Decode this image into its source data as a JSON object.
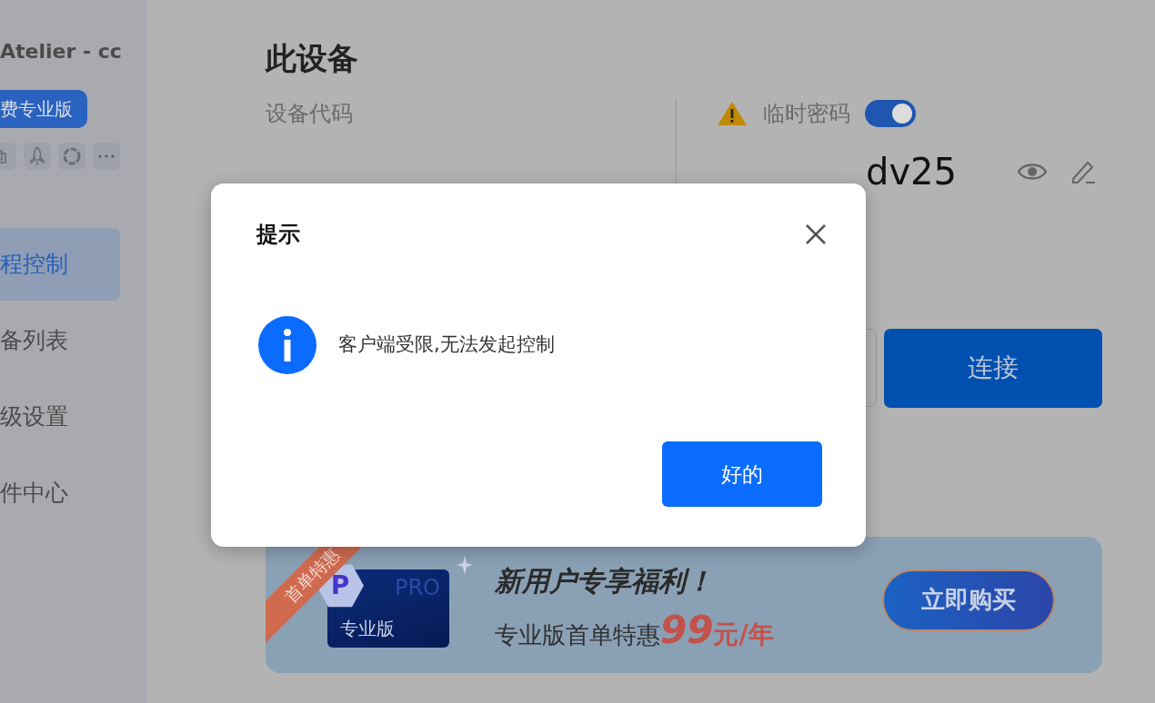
{
  "sidebar": {
    "title": "Atelier - cc",
    "upgrade_button": "费专业版",
    "nav_items": [
      {
        "label": "程控制",
        "selected": true
      },
      {
        "label": "备列表",
        "selected": false
      },
      {
        "label": "级设置",
        "selected": false
      },
      {
        "label": "件中心",
        "selected": false
      }
    ]
  },
  "main": {
    "heading": "此设备",
    "device_code": {
      "label": "设备代码"
    },
    "temp_password": {
      "label": "临时密码",
      "on": true,
      "value": "dv25"
    },
    "connect_button": "连接",
    "promo": {
      "ribbon": "首单特惠",
      "product_card": {
        "logo_letter": "P",
        "badge": "PRO",
        "label": "专业版"
      },
      "title": "新用户专享福利！",
      "subtitle": "专业版首单特惠",
      "price": "99",
      "unit": "元/年",
      "buy_button": "立即购买"
    }
  },
  "dialog": {
    "title": "提示",
    "message": "客户端受限,无法发起控制",
    "ok_button": "好的"
  }
}
